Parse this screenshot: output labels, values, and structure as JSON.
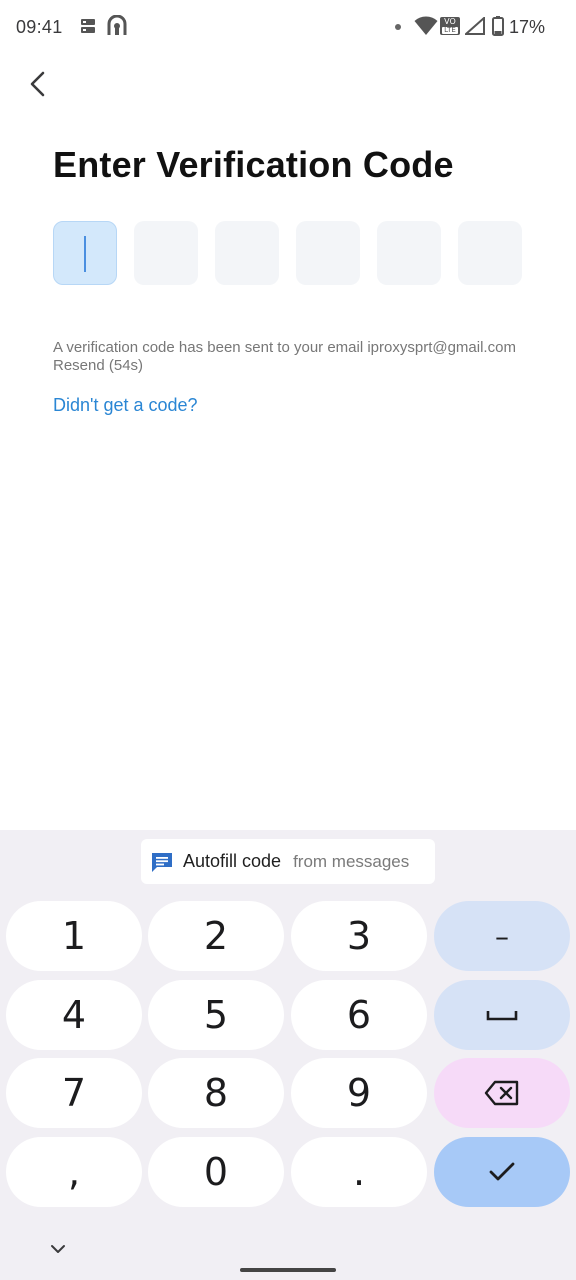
{
  "status_bar": {
    "time": "09:41",
    "battery_percent": "17%",
    "icons": [
      "storage-icon",
      "vpn-icon",
      "dot-icon",
      "wifi-icon",
      "volte-icon",
      "signal-icon",
      "battery-icon"
    ],
    "volte_top": "VO",
    "volte_bottom": "LTE"
  },
  "header": {
    "back_icon": "chevron-left-icon"
  },
  "main": {
    "title": "Enter Verification Code",
    "code_length": 6,
    "code_values": [
      "",
      "",
      "",
      "",
      "",
      ""
    ],
    "sent_message": "A verification code has been sent to your email iproxysprt@gmail.com Resend (54s)",
    "help_link": "Didn't get a code?"
  },
  "keyboard": {
    "autofill_main": "Autofill code",
    "autofill_sub": "from messages",
    "keys": [
      "1",
      "2",
      "3",
      "–",
      "4",
      "5",
      "6",
      "␣",
      "7",
      "8",
      "9",
      "⌫",
      ",",
      "0",
      ".",
      "✓"
    ],
    "k1": "1",
    "k2": "2",
    "k3": "3",
    "k_minus": "–",
    "k4": "4",
    "k5": "5",
    "k6": "6",
    "k7": "7",
    "k8": "8",
    "k9": "9",
    "k_comma": ",",
    "k0": "0",
    "k_dot": "."
  },
  "colors": {
    "accent": "#2a86d4",
    "active_box": "#d3e8fb",
    "keyboard_bg": "#f1eff4",
    "func_key": "#d6e2f6",
    "delete_key": "#f6daf8",
    "done_key": "#a7c9f7"
  }
}
